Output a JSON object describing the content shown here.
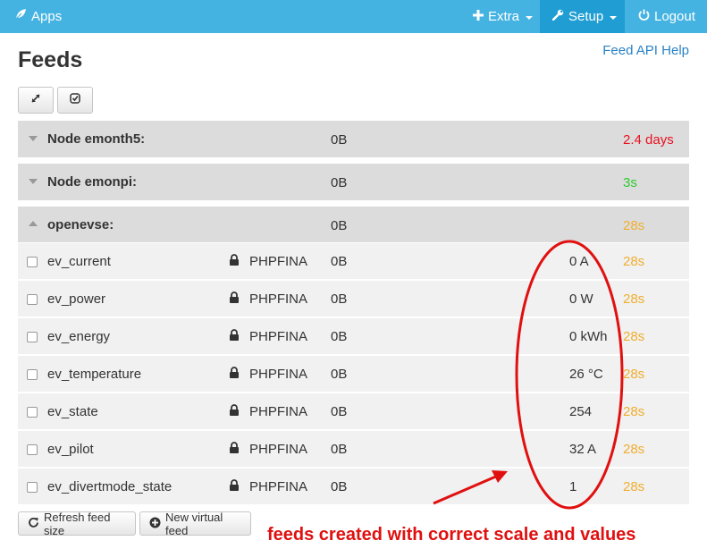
{
  "nav": {
    "brand": "Apps",
    "extra": "Extra",
    "setup": "Setup",
    "logout": "Logout"
  },
  "page": {
    "title": "Feeds",
    "api_help": "Feed API Help"
  },
  "nodes": [
    {
      "name": "Node emonth5:",
      "size": "0B",
      "time": "2.4 days",
      "time_color": "#e8101f",
      "expanded": false
    },
    {
      "name": "Node emonpi:",
      "size": "0B",
      "time": "3s",
      "time_color": "#2ec92e",
      "expanded": false
    },
    {
      "name": "openevse:",
      "size": "0B",
      "time": "28s",
      "time_color": "#f0ae30",
      "expanded": true
    }
  ],
  "feeds": [
    {
      "name": "ev_current",
      "engine": "PHPFINA",
      "size": "0B",
      "value": "0 A",
      "time": "28s"
    },
    {
      "name": "ev_power",
      "engine": "PHPFINA",
      "size": "0B",
      "value": "0 W",
      "time": "28s"
    },
    {
      "name": "ev_energy",
      "engine": "PHPFINA",
      "size": "0B",
      "value": "0 kWh",
      "time": "28s"
    },
    {
      "name": "ev_temperature",
      "engine": "PHPFINA",
      "size": "0B",
      "value": "26 °C",
      "time": "28s"
    },
    {
      "name": "ev_state",
      "engine": "PHPFINA",
      "size": "0B",
      "value": "254",
      "time": "28s"
    },
    {
      "name": "ev_pilot",
      "engine": "PHPFINA",
      "size": "0B",
      "value": "32 A",
      "time": "28s"
    },
    {
      "name": "ev_divertmode_state",
      "engine": "PHPFINA",
      "size": "0B",
      "value": "1",
      "time": "28s"
    }
  ],
  "buttons": {
    "refresh": "Refresh feed size",
    "new_virtual": "New virtual feed"
  },
  "annotation": {
    "text": "feeds created with correct scale and values",
    "color": "#e01010"
  },
  "colors": {
    "nav_bg": "#44b3e2",
    "nav_active": "#209ed4",
    "link": "#2a82c7",
    "recent_time": "#f0ae30"
  }
}
